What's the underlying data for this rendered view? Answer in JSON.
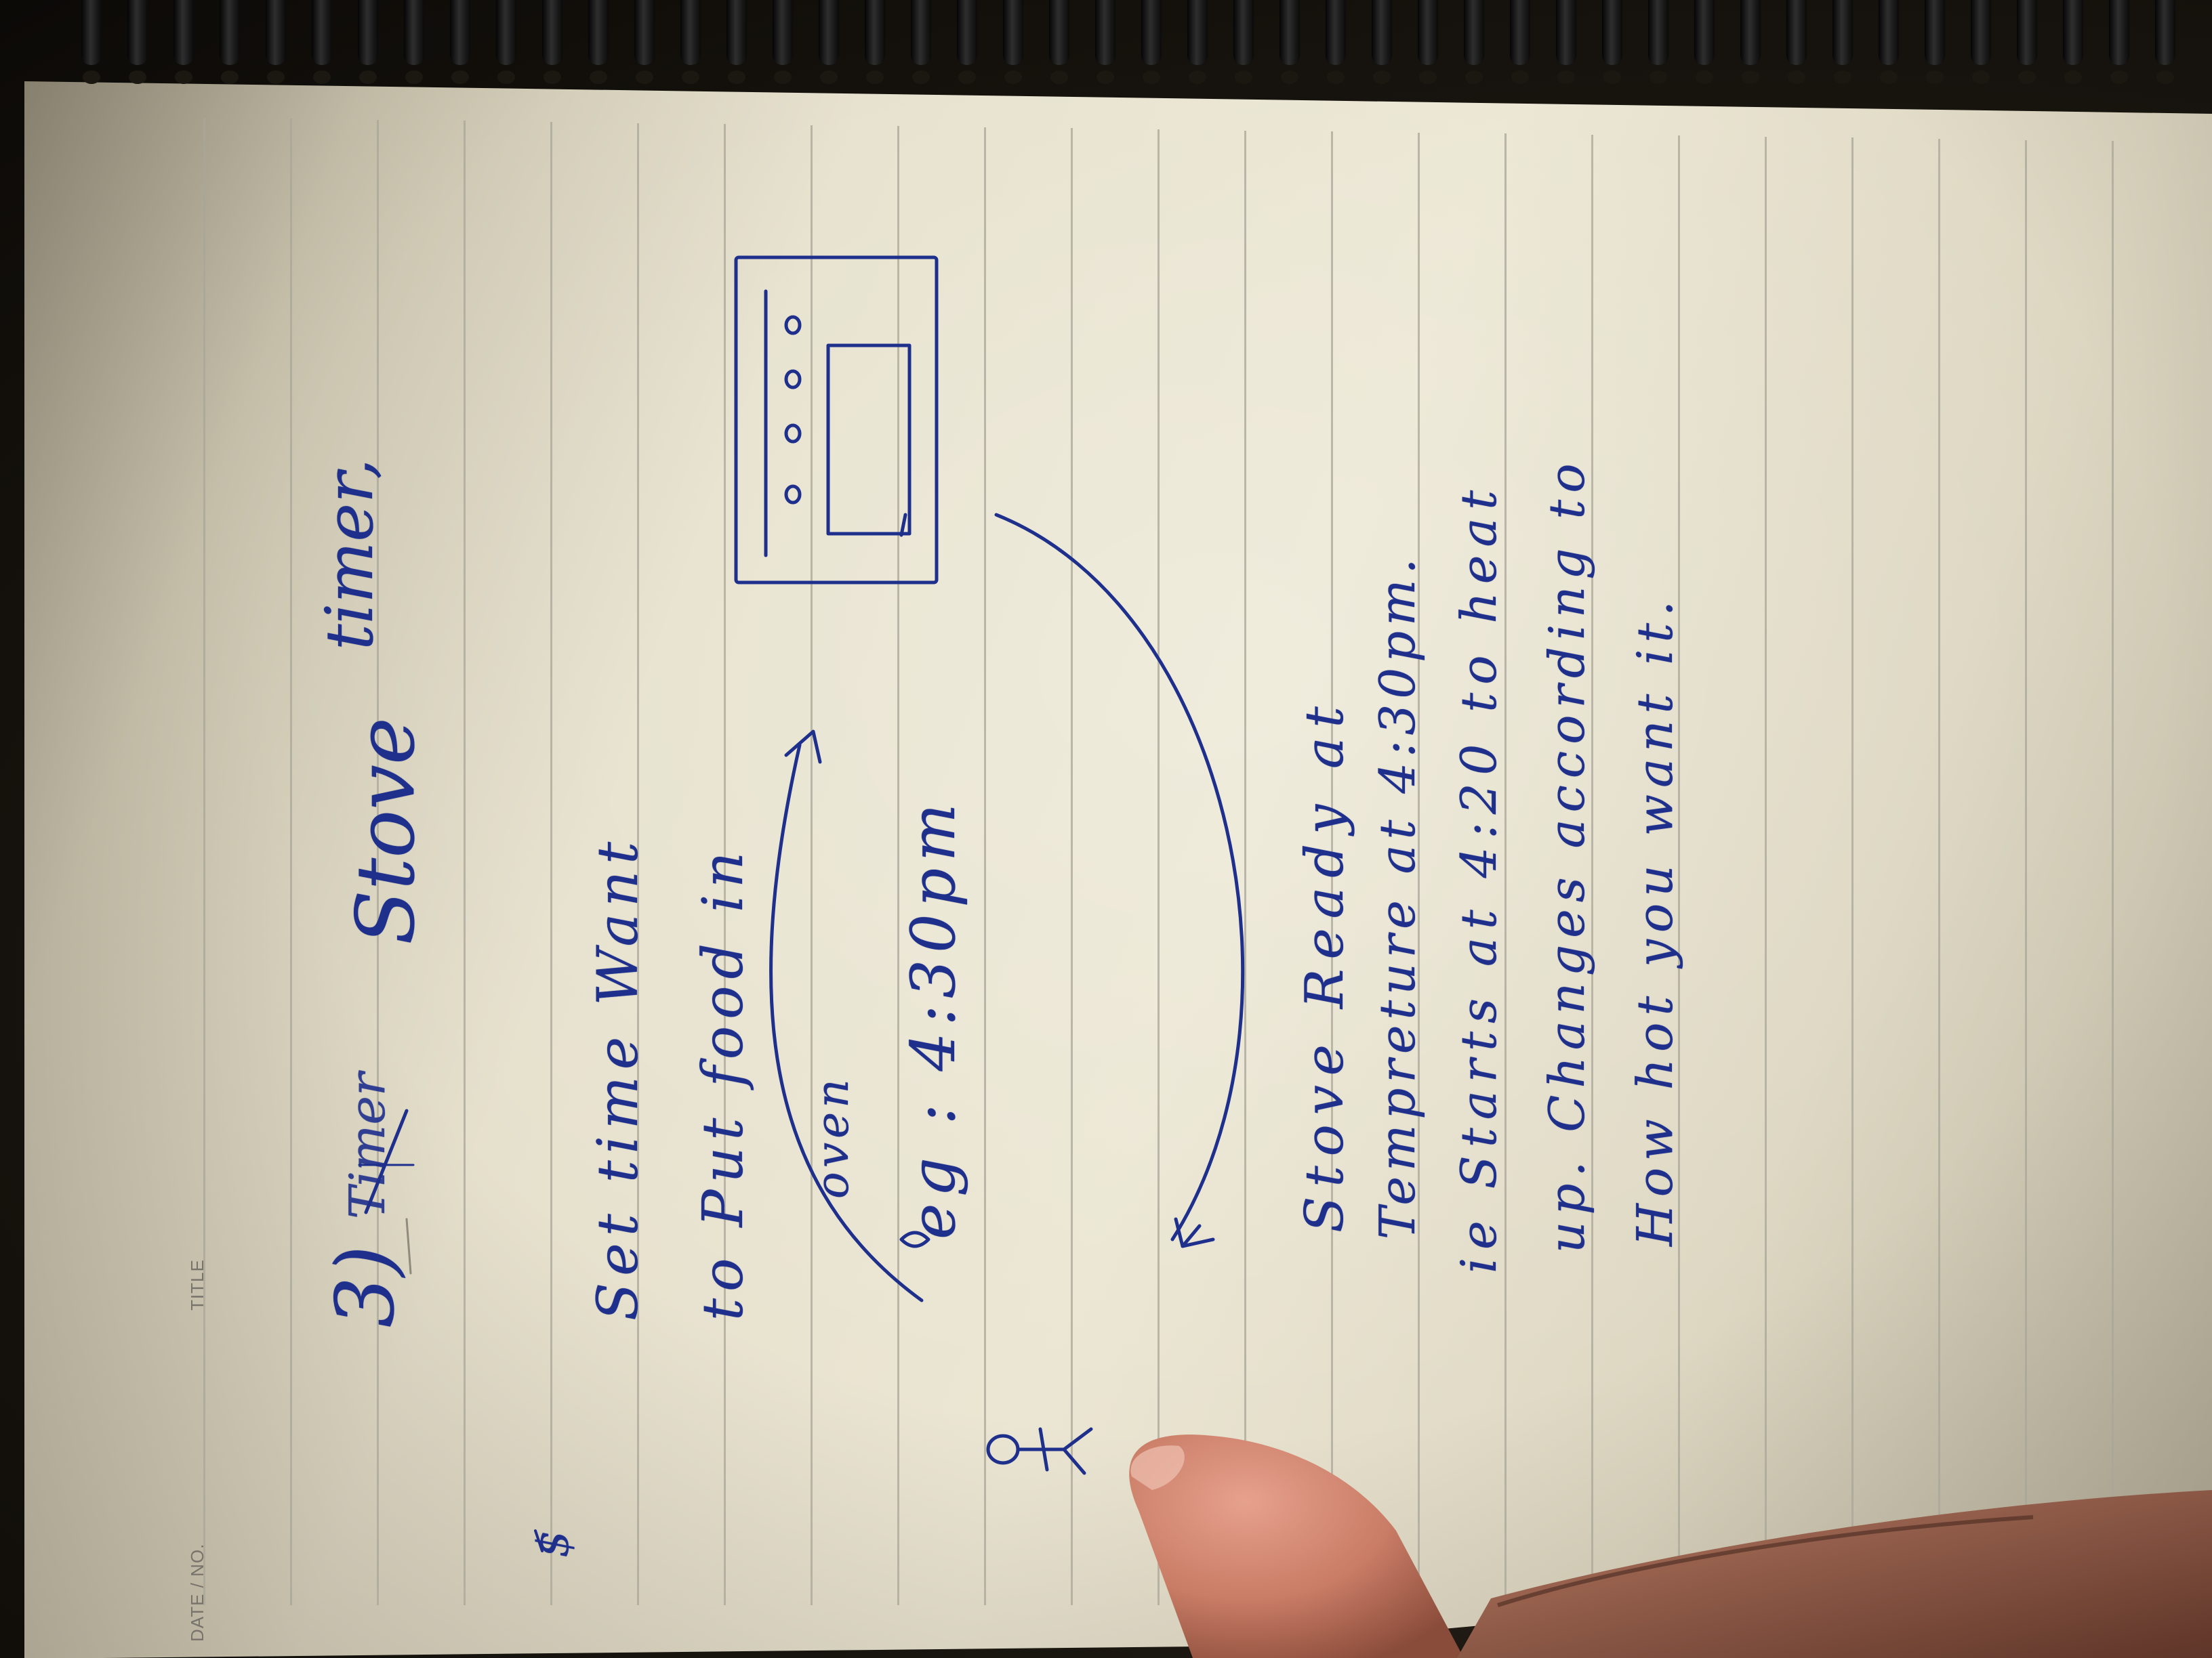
{
  "photo": {
    "printed_labels": {
      "date": "DATE / NO.",
      "title": "TITLE"
    },
    "handwriting": {
      "heading_number": "3)",
      "heading_struck": "Timer",
      "heading_word": "Stove",
      "heading_tail": "timer,",
      "top_left_mark": "$",
      "line1": "Set time Want",
      "line2": "to Put food in",
      "line3": "oven",
      "line4": "eg : 4:30pm",
      "line5": "Stove Ready at",
      "line6": "Tempreture at 4:30pm.",
      "line7": "ie Starts at 4:20 to heat",
      "line8": "up. Changes according to",
      "line9": "How hot you want it."
    },
    "colors": {
      "ink": "#1e2f8c",
      "paper": "#e8e3cf",
      "rule": "#a9a597",
      "skin": "#d89580"
    }
  }
}
